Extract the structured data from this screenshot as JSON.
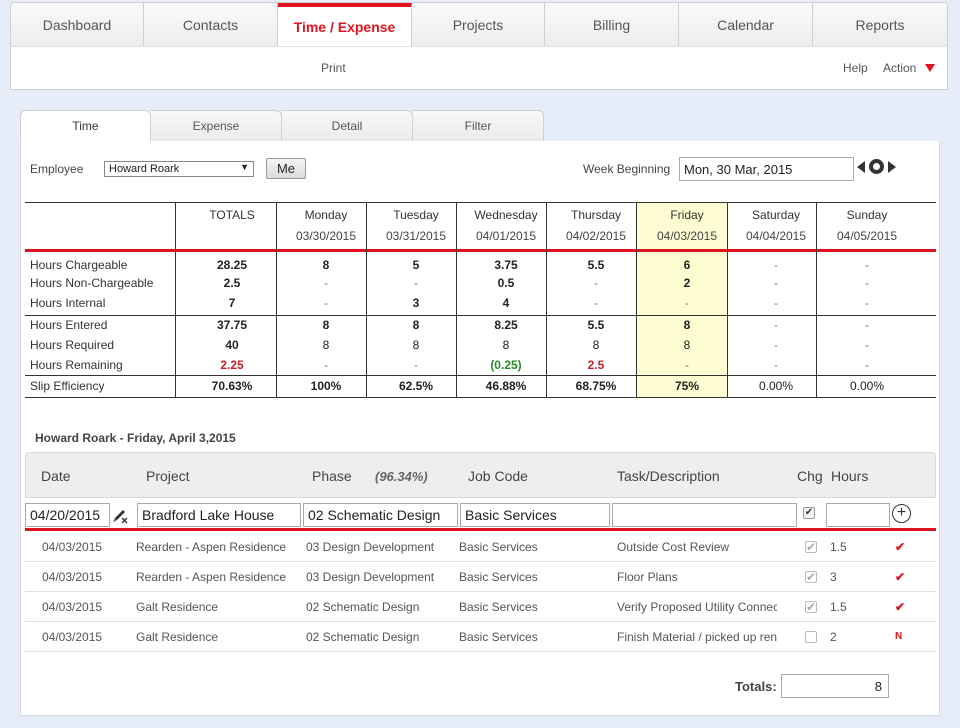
{
  "nav": {
    "tabs": [
      {
        "label": "Dashboard"
      },
      {
        "label": "Contacts"
      },
      {
        "label": "Time / Expense"
      },
      {
        "label": "Projects"
      },
      {
        "label": "Billing"
      },
      {
        "label": "Calendar"
      },
      {
        "label": "Reports"
      }
    ],
    "active_index": 2
  },
  "subbar": {
    "print": "Print",
    "help": "Help",
    "action": "Action"
  },
  "inner_tabs": [
    {
      "label": "Time"
    },
    {
      "label": "Expense"
    },
    {
      "label": "Detail"
    },
    {
      "label": "Filter"
    }
  ],
  "employee": {
    "label": "Employee",
    "value": "Howard Roark",
    "me_button": "Me"
  },
  "week": {
    "label": "Week Beginning",
    "value": "Mon, 30 Mar, 2015"
  },
  "summary": {
    "columns": [
      {
        "name": "TOTALS",
        "date": ""
      },
      {
        "name": "Monday",
        "date": "03/30/2015"
      },
      {
        "name": "Tuesday",
        "date": "03/31/2015"
      },
      {
        "name": "Wednesday",
        "date": "04/01/2015"
      },
      {
        "name": "Thursday",
        "date": "04/02/2015"
      },
      {
        "name": "Friday",
        "date": "04/03/2015"
      },
      {
        "name": "Saturday",
        "date": "04/04/2015"
      },
      {
        "name": "Sunday",
        "date": "04/05/2015"
      }
    ],
    "rows": [
      {
        "label": "Hours Chargeable",
        "values": [
          "28.25",
          "8",
          "5",
          "3.75",
          "5.5",
          "6",
          "-",
          "-"
        ]
      },
      {
        "label": "Hours Non-Chargeable",
        "values": [
          "2.5",
          "-",
          "-",
          "0.5",
          "-",
          "2",
          "-",
          "-"
        ]
      },
      {
        "label": "Hours Internal",
        "values": [
          "7",
          "-",
          "3",
          "4",
          "-",
          "-",
          "-",
          "-"
        ]
      },
      {
        "label": "Hours Entered",
        "values": [
          "37.75",
          "8",
          "8",
          "8.25",
          "5.5",
          "8",
          "-",
          "-"
        ]
      },
      {
        "label": "Hours Required",
        "values": [
          "40",
          "8",
          "8",
          "8",
          "8",
          "8",
          "-",
          "-"
        ]
      },
      {
        "label": "Hours Remaining",
        "values": [
          "2.25",
          "-",
          "-",
          "(0.25)",
          "2.5",
          "-",
          "-",
          "-"
        ]
      },
      {
        "label": "Slip Efficiency",
        "values": [
          "70.63%",
          "100%",
          "62.5%",
          "46.88%",
          "68.75%",
          "75%",
          "0.00%",
          "0.00%"
        ]
      }
    ]
  },
  "detail": {
    "title": "Howard Roark - Friday, April 3,2015",
    "headers": {
      "date": "Date",
      "project": "Project",
      "phase": "Phase",
      "pct": "(96.34%)",
      "job_code": "Job Code",
      "task": "Task/Description",
      "chg": "Chg",
      "hours": "Hours"
    },
    "entry": {
      "date": "04/20/2015",
      "project": "Bradford Lake House",
      "phase": "02 Schematic Design",
      "job_code": "Basic Services",
      "task": "",
      "hours": ""
    },
    "rows": [
      {
        "date": "04/03/2015",
        "project": "Rearden - Aspen Residence",
        "phase": "03 Design Development",
        "job_code": "Basic Services",
        "task": "Outside Cost Review",
        "chg": true,
        "hours": "1.5",
        "status": "✔"
      },
      {
        "date": "04/03/2015",
        "project": "Rearden - Aspen Residence",
        "phase": "03 Design Development",
        "job_code": "Basic Services",
        "task": "Floor Plans",
        "chg": true,
        "hours": "3",
        "status": "✔"
      },
      {
        "date": "04/03/2015",
        "project": "Galt Residence",
        "phase": "02 Schematic Design",
        "job_code": "Basic Services",
        "task": "Verify Proposed Utility Connections",
        "chg": true,
        "hours": "1.5",
        "status": "✔"
      },
      {
        "date": "04/03/2015",
        "project": "Galt Residence",
        "phase": "02 Schematic Design",
        "job_code": "Basic Services",
        "task": "Finish Material / picked up renderings",
        "chg": false,
        "hours": "2",
        "status": "N"
      }
    ],
    "totals_label": "Totals:",
    "totals_value": "8"
  }
}
